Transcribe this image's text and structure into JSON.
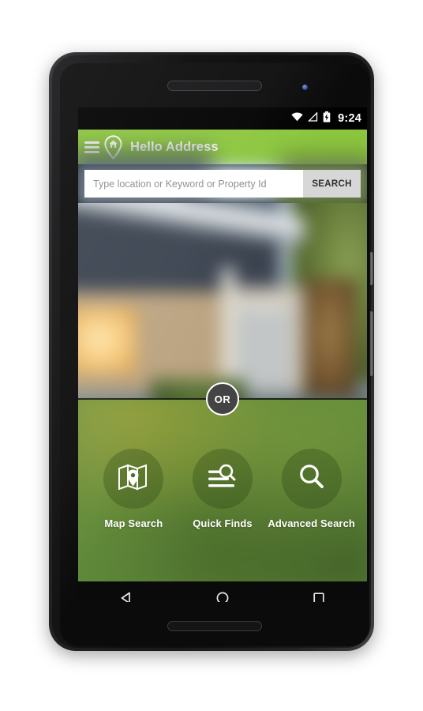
{
  "device": {
    "name": "android-phone-mockup",
    "frame_color": "#1a1a1c"
  },
  "statusbar": {
    "time": "9:24",
    "icons": [
      "wifi-icon",
      "signal-icon",
      "battery-charging-icon"
    ],
    "background": "#000000"
  },
  "appbar": {
    "title": "Hello Address",
    "menu_icon": "hamburger-menu-icon",
    "logo_icon": "home-pin-logo-icon",
    "background": "#8cc63e",
    "text_color": "#ffffff"
  },
  "search": {
    "placeholder": "Type location or Keyword or Property Id",
    "value": "",
    "button_label": "SEARCH",
    "button_background": "#d7d7d7",
    "field_background": "#ffffff"
  },
  "hero": {
    "alt": "blurred photo of a house exterior at dusk"
  },
  "divider": {
    "or_label": "OR",
    "badge_background": "#444444",
    "badge_border": "#ffffff"
  },
  "actions": {
    "background": "#5f8a38",
    "items": [
      {
        "label": "Map Search",
        "icon": "map-pin-icon"
      },
      {
        "label": "Quick Finds",
        "icon": "list-search-icon"
      },
      {
        "label": "Advanced Search",
        "icon": "magnifier-icon"
      }
    ]
  },
  "navbar": {
    "background": "#0a0a0a",
    "buttons": [
      {
        "name": "back-button",
        "icon": "triangle-back-icon"
      },
      {
        "name": "home-button",
        "icon": "circle-home-icon"
      },
      {
        "name": "recents-button",
        "icon": "square-recents-icon"
      }
    ]
  }
}
